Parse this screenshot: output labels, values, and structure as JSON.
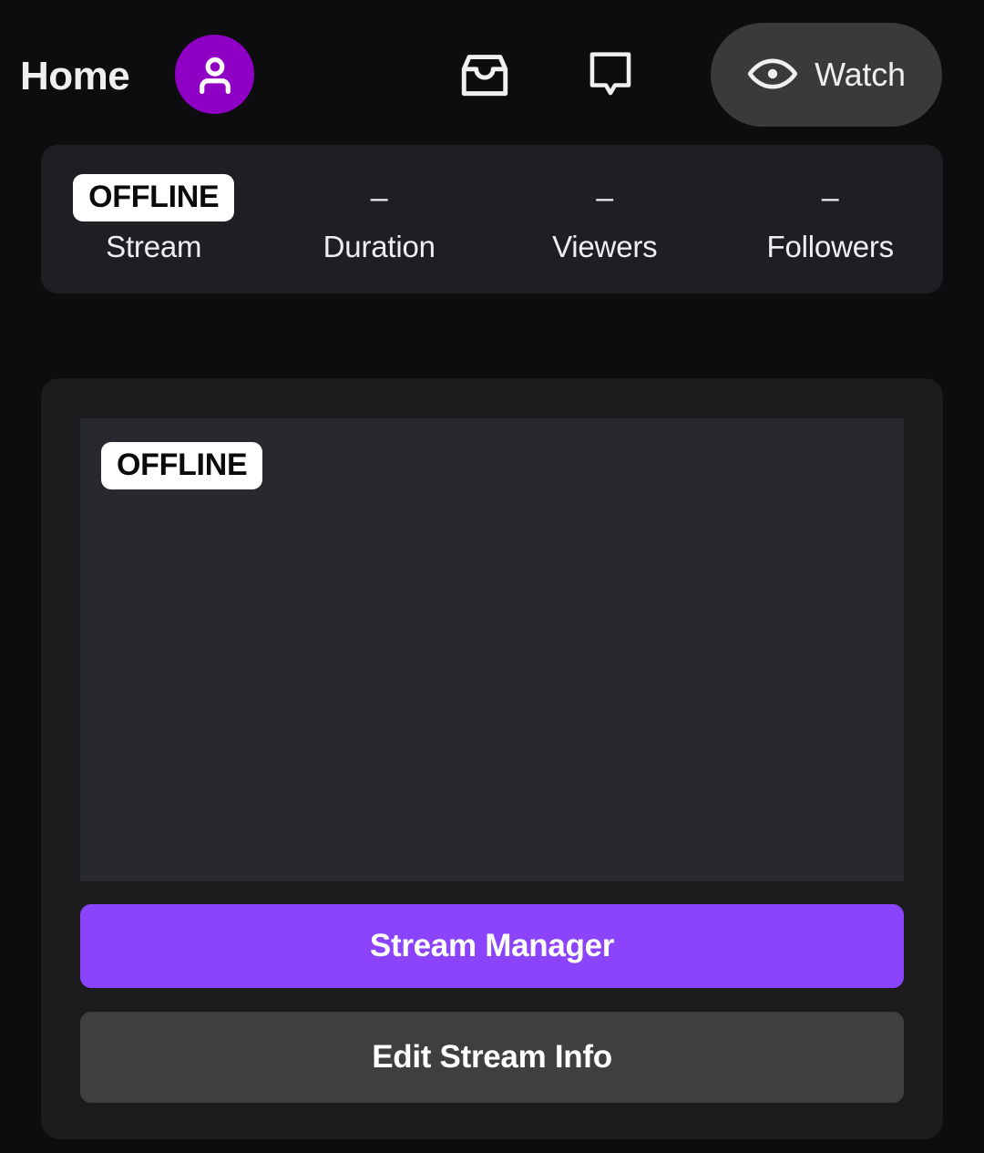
{
  "header": {
    "title": "Home",
    "avatar_icon": "user-avatar-icon",
    "avatar_color": "#9000c4",
    "inbox_icon": "inbox-icon",
    "chat_icon": "chat-bubble-icon",
    "watch": {
      "label": "Watch",
      "icon": "eye-icon",
      "background": "#3a3a3d"
    }
  },
  "stats": {
    "items": [
      {
        "value": "OFFLINE",
        "label": "Stream",
        "is_badge": true
      },
      {
        "value": "–",
        "label": "Duration",
        "is_badge": false
      },
      {
        "value": "–",
        "label": "Viewers",
        "is_badge": false
      },
      {
        "value": "–",
        "label": "Followers",
        "is_badge": false
      }
    ],
    "card_background": "#1f1f23"
  },
  "channel": {
    "card_background": "#1c1c1f",
    "preview": {
      "status_badge": "OFFLINE",
      "background": "#28282f"
    },
    "actions": {
      "stream_manager": {
        "label": "Stream Manager",
        "color": "#8b44fc"
      },
      "edit_stream_info": {
        "label": "Edit Stream Info",
        "color": "#3f3f42"
      }
    }
  },
  "theme": {
    "page_background": "#0d0d0f",
    "text_primary": "#efeff1",
    "accent": "#8b44fc"
  }
}
